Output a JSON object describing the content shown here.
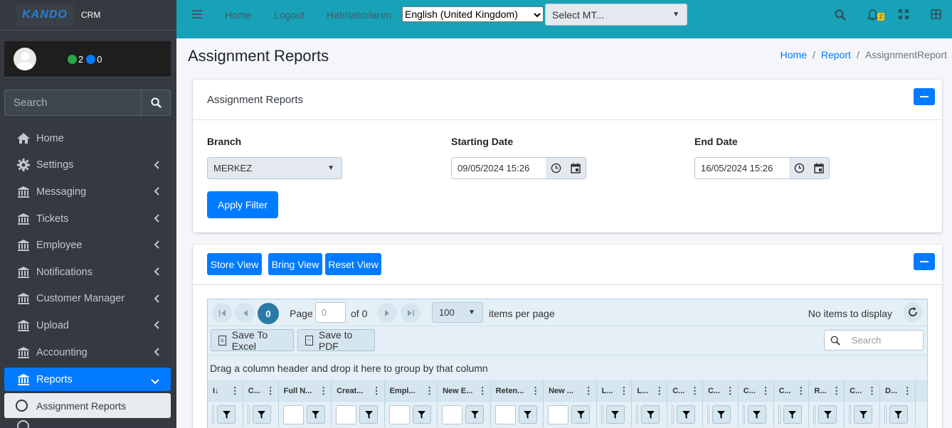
{
  "brand": {
    "logo_text": "KANDO",
    "name": "CRM"
  },
  "user": {
    "green_count": "2",
    "blue_count": "0"
  },
  "sidebar": {
    "search_placeholder": "Search",
    "items": [
      {
        "label": "Home",
        "icon": "home-icon"
      },
      {
        "label": "Settings",
        "icon": "gear-icon"
      },
      {
        "label": "Messaging",
        "icon": "building-icon"
      },
      {
        "label": "Tickets",
        "icon": "building-icon"
      },
      {
        "label": "Employee",
        "icon": "building-icon"
      },
      {
        "label": "Notifications",
        "icon": "building-icon"
      },
      {
        "label": "Customer Manager",
        "icon": "building-icon"
      },
      {
        "label": "Upload",
        "icon": "building-icon"
      },
      {
        "label": "Accounting",
        "icon": "building-icon"
      },
      {
        "label": "Reports",
        "icon": "building-icon"
      }
    ],
    "sub_items": [
      {
        "label": "Assignment Reports"
      }
    ]
  },
  "topbar": {
    "links": [
      "Home",
      "Logout",
      "Hatırlatıcılarım"
    ],
    "language": "English (United Kingdom)",
    "mt_select": "Select MT...",
    "notification_badge": "2",
    "color": "#17a2b8"
  },
  "page": {
    "title": "Assignment Reports",
    "breadcrumb": [
      "Home",
      "Report",
      "AssignmentReport"
    ]
  },
  "filter_card": {
    "title": "Assignment Reports",
    "branch_label": "Branch",
    "branch_value": "MERKEZ",
    "start_label": "Starting Date",
    "start_value": "09/05/2024 15:26",
    "end_label": "End Date",
    "end_value": "16/05/2024 15:26",
    "apply_label": "Apply Filter"
  },
  "grid_card": {
    "store_view": "Store View",
    "bring_view": "Bring View",
    "reset_view": "Reset View",
    "pager": {
      "current_page": "0",
      "page_label": "Page",
      "page_input": "0",
      "of_label": "of 0",
      "page_size": "100",
      "items_per_page": "items per page",
      "status": "No items to display"
    },
    "toolbar": {
      "excel": "Save To Excel",
      "pdf": "Save to PDF",
      "search_placeholder": "Search"
    },
    "group_hint": "Drag a column header and drop it here to group by that column",
    "columns": [
      "I↓",
      "C...",
      "Full N...",
      "Creat...",
      "Empl...",
      "New E...",
      "Reten...",
      "New ...",
      "L...",
      "L...",
      "C...",
      "C...",
      "C...",
      "C...",
      "R...",
      "C...",
      "D..."
    ]
  }
}
